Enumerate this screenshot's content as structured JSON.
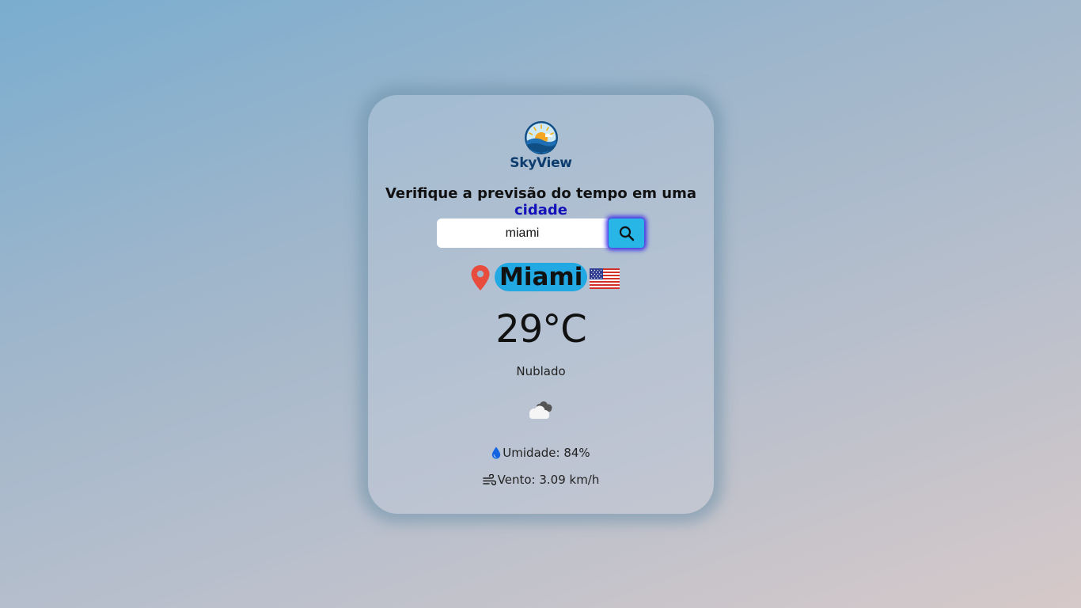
{
  "app": {
    "logo_text": "SkyView",
    "logo_icon": "sun-horizon-icon"
  },
  "headline": {
    "prefix": "Verifique a previsão do tempo em uma ",
    "accent": "cidade"
  },
  "search": {
    "value": "miami",
    "placeholder": "",
    "button_icon": "search-icon"
  },
  "weather": {
    "city": "Miami",
    "country_flag_icon": "us-flag-icon",
    "location_icon": "map-pin-icon",
    "temperature": "29°C",
    "condition": "Nublado",
    "condition_icon": "cloud-icon",
    "humidity_label": "Umidade: 84%",
    "humidity_icon": "water-drop-icon",
    "wind_label": "Vento: 3.09 km/h",
    "wind_icon": "wind-icon"
  },
  "colors": {
    "accent_text": "#1212b8",
    "city_highlight": "#22a9e3",
    "search_button": "#27b6e6",
    "search_button_glow": "#3b2fe6",
    "pin": "#e74c3c",
    "logo_text": "#0d3d6e"
  }
}
